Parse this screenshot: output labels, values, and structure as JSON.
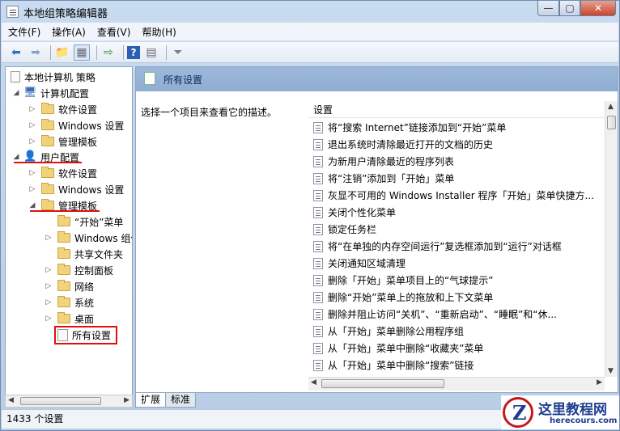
{
  "window": {
    "title": "本地组策略编辑器",
    "btn_min": "—",
    "btn_max": "▢",
    "btn_close": "✕"
  },
  "menu": [
    "文件(F)",
    "操作(A)",
    "查看(V)",
    "帮助(H)"
  ],
  "tree": {
    "root": "本地计算机 策略",
    "computer_config": "计算机配置",
    "cc_items": [
      "软件设置",
      "Windows 设置",
      "管理模板"
    ],
    "user_config": "用户配置",
    "uc_items": [
      "软件设置",
      "Windows 设置"
    ],
    "admin_templates": "管理模板",
    "at_items": [
      "“开始”菜单",
      "Windows 组件",
      "共享文件夹",
      "控制面板",
      "网络",
      "系统",
      "桌面"
    ],
    "all_settings": "所有设置"
  },
  "right": {
    "header": "所有设置",
    "description": "选择一个项目来查看它的描述。",
    "column_header": "设置",
    "rows": [
      "将“搜索 Internet”链接添加到“开始”菜单",
      "退出系统时清除最近打开的文档的历史",
      "为新用户清除最近的程序列表",
      "将“注销”添加到「开始」菜单",
      "灰显不可用的 Windows Installer 程序「开始」菜单快捷方...",
      "关闭个性化菜单",
      "锁定任务栏",
      "将“在单独的内存空间运行”复选框添加到“运行”对话框",
      "关闭通知区域清理",
      "删除「开始」菜单项目上的“气球提示”",
      "删除“开始”菜单上的拖放和上下文菜单",
      "删除并阻止访问“关机”、“重新启动”、“睡眠”和“休...",
      "从「开始」菜单删除公用程序组",
      "从「开始」菜单中删除“收藏夹”菜单",
      "从「开始」菜单中删除“搜索”链接"
    ]
  },
  "tabs": [
    "扩展",
    "标准"
  ],
  "status": "1433 个设置",
  "watermark": {
    "title": "这里教程网",
    "url": "herecours.com"
  },
  "colors": {
    "accent_red": "#e01010",
    "header_blue": "#9db8d9"
  }
}
